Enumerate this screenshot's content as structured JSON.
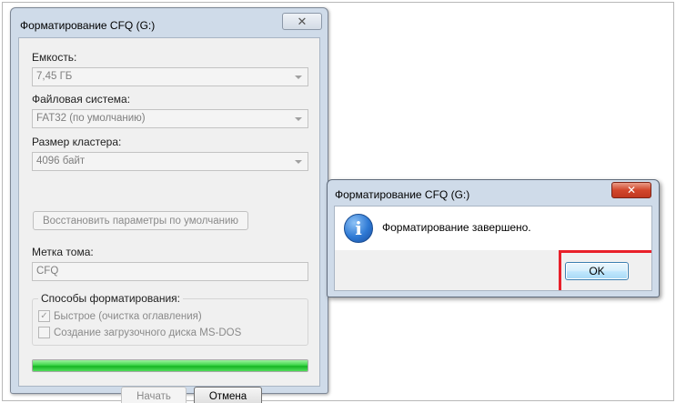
{
  "format_window": {
    "title": "Форматирование CFQ (G:)",
    "close_glyph": "✕",
    "capacity_label": "Емкость:",
    "capacity_value": "7,45 ГБ",
    "filesystem_label": "Файловая система:",
    "filesystem_value": "FAT32 (по умолчанию)",
    "cluster_label": "Размер кластера:",
    "cluster_value": "4096 байт",
    "restore_button": "Восстановить параметры по умолчанию",
    "volume_label": "Метка тома:",
    "volume_value": "CFQ",
    "options_group": "Способы форматирования:",
    "quick_format_label": "Быстрое (очистка оглавления)",
    "quick_format_checked": true,
    "msdos_label": "Создание загрузочного диска MS-DOS",
    "msdos_checked": false,
    "progress": 1.0,
    "start_button": "Начать",
    "cancel_button": "Отмена"
  },
  "message_box": {
    "title": "Форматирование CFQ (G:)",
    "close_glyph": "✕",
    "icon": "info-icon",
    "icon_glyph": "i",
    "text": "Форматирование завершено.",
    "ok_button": "OK",
    "highlight_color": "#e8202a"
  }
}
